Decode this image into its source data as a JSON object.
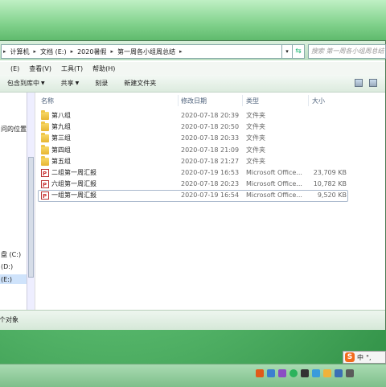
{
  "address": {
    "crumbs": [
      "计算机",
      "文档 (E:)",
      "2020暑假",
      "第一周各小组周总结"
    ],
    "search_placeholder": "搜索 第一周各小组周总结"
  },
  "menu": [
    "(E)",
    "查看(V)",
    "工具(T)",
    "帮助(H)"
  ],
  "toolbar": {
    "include_label": "包含到库中",
    "share_label": "共享",
    "burn_label": "刻录",
    "new_folder_label": "新建文件夹"
  },
  "nav": {
    "item1": "问的位置",
    "drive_c": "盘 (C:)",
    "drive_d": "(D:)",
    "drive_e": "(E:)"
  },
  "columns": {
    "name": "名称",
    "date": "修改日期",
    "type": "类型",
    "size": "大小"
  },
  "files": [
    {
      "name": "第八组",
      "date": "2020-07-18 20:39",
      "type": "文件夹",
      "size": "",
      "icon": "folder-icon"
    },
    {
      "name": "第九组",
      "date": "2020-07-18 20:50",
      "type": "文件夹",
      "size": "",
      "icon": "folder-icon"
    },
    {
      "name": "第三组",
      "date": "2020-07-18 20:33",
      "type": "文件夹",
      "size": "",
      "icon": "folder-icon"
    },
    {
      "name": "第四组",
      "date": "2020-07-18 21:09",
      "type": "文件夹",
      "size": "",
      "icon": "folder-icon"
    },
    {
      "name": "第五组",
      "date": "2020-07-18 21:27",
      "type": "文件夹",
      "size": "",
      "icon": "folder-icon"
    },
    {
      "name": "二组第一周汇报",
      "date": "2020-07-19 16:53",
      "type": "Microsoft Office...",
      "size": "23,709 KB",
      "icon": "ppt-icon"
    },
    {
      "name": "六组第一周汇报",
      "date": "2020-07-18 20:23",
      "type": "Microsoft Office...",
      "size": "10,782 KB",
      "icon": "ppt-icon"
    },
    {
      "name": "一组第一周汇报",
      "date": "2020-07-19 16:54",
      "type": "Microsoft Office...",
      "size": "9,520 KB",
      "icon": "ppt-icon"
    }
  ],
  "status": {
    "text": "个对象"
  },
  "ime": {
    "s": "S",
    "lang": "中"
  }
}
